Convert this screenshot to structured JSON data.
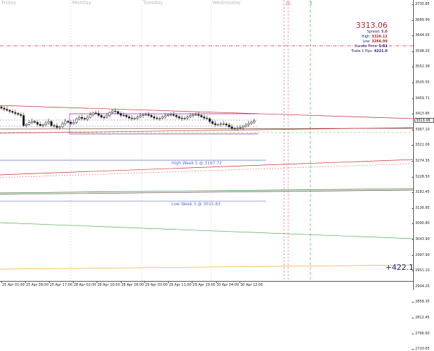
{
  "chart": {
    "days": [
      "Friday",
      "Monday",
      "Tuesday",
      "Wednesday"
    ],
    "vlabels": [
      {
        "text": "20",
        "color": "#e66aa3"
      },
      {
        "text": "5",
        "color": "#4caf50"
      }
    ],
    "y_ticks": [
      "3735.85",
      "3689.99",
      "3644.05",
      "3598.25",
      "3552.38",
      "3505.55",
      "3459.71",
      "3413.95",
      "3367.10",
      "3321.00",
      "3274.35",
      "3228.50",
      "3182.45",
      "3136.85",
      "3090.80",
      "3043.90",
      "2997.90",
      "2951.10",
      "2904.25",
      "2858.35",
      "2812.45",
      "2766.60",
      "2720.65"
    ],
    "current_price_tag": "3313.06",
    "x_ticks": [
      "25 Apr 01:00",
      "25 Apr 09:00",
      "25 Apr 17:00",
      "28 Apr 02:00",
      "28 Apr 10:00",
      "28 Apr 18:00",
      "29 Apr 03:00",
      "29 Apr 11:00",
      "29 Apr 19:00",
      "30 Apr 04:00",
      "30 Apr 12:00"
    ]
  },
  "info": {
    "price": "3313.06",
    "rows": [
      {
        "key": "Spread",
        "value": "5.0",
        "color": "#b22222"
      },
      {
        "key": "High",
        "value": "3326.12",
        "color": "#b22222"
      },
      {
        "key": "Low",
        "value": "3266.99",
        "color": "#b22222"
      },
      {
        "key": "Candle Time",
        "value": "5:51",
        "color": "#1a237e"
      },
      {
        "key": "Trade 1 Pips",
        "value": "4221.0",
        "color": "#1a237e"
      }
    ]
  },
  "labels": {
    "high_week": "High Week 5 @ 3167.72",
    "low_week": "Low Week 5 @ 3015.83"
  },
  "pips": "+422.1",
  "colors": {
    "bull": "#111111",
    "accent_red": "#b22222",
    "accent_blue": "#1a237e"
  }
}
